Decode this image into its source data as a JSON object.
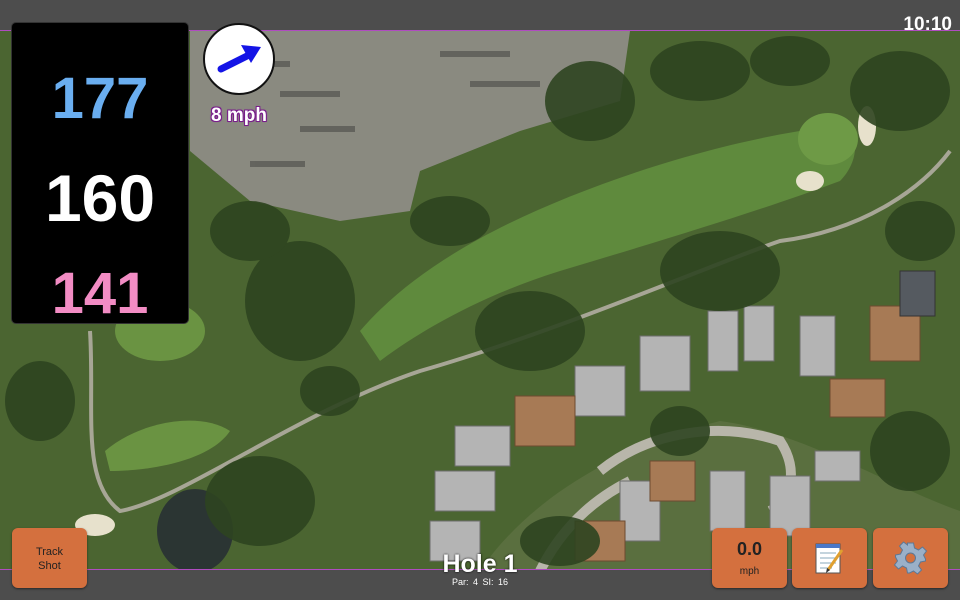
{
  "status_bar": {
    "time": "10:10"
  },
  "distances": {
    "back": "177",
    "middle": "160",
    "front": "141",
    "colors": {
      "back": "#6aaef0",
      "middle": "#ffffff",
      "front": "#f28cc4"
    }
  },
  "wind": {
    "speed": "8 mph",
    "arrow_icon": "arrow-icon",
    "arrow_color": "#1414e6"
  },
  "buttons": {
    "track_shot": "Track\nShot",
    "speed_value": "0.0",
    "speed_unit": "mph",
    "notes_icon": "notepad-icon",
    "settings_icon": "gear-icon"
  },
  "hole": {
    "title": "Hole 1",
    "par": "Par: 4",
    "stroke_index": "SI: 16"
  },
  "colors": {
    "button": "#d4703e",
    "frame_accent": "#b04cc0",
    "bar": "#4d4d4d"
  }
}
